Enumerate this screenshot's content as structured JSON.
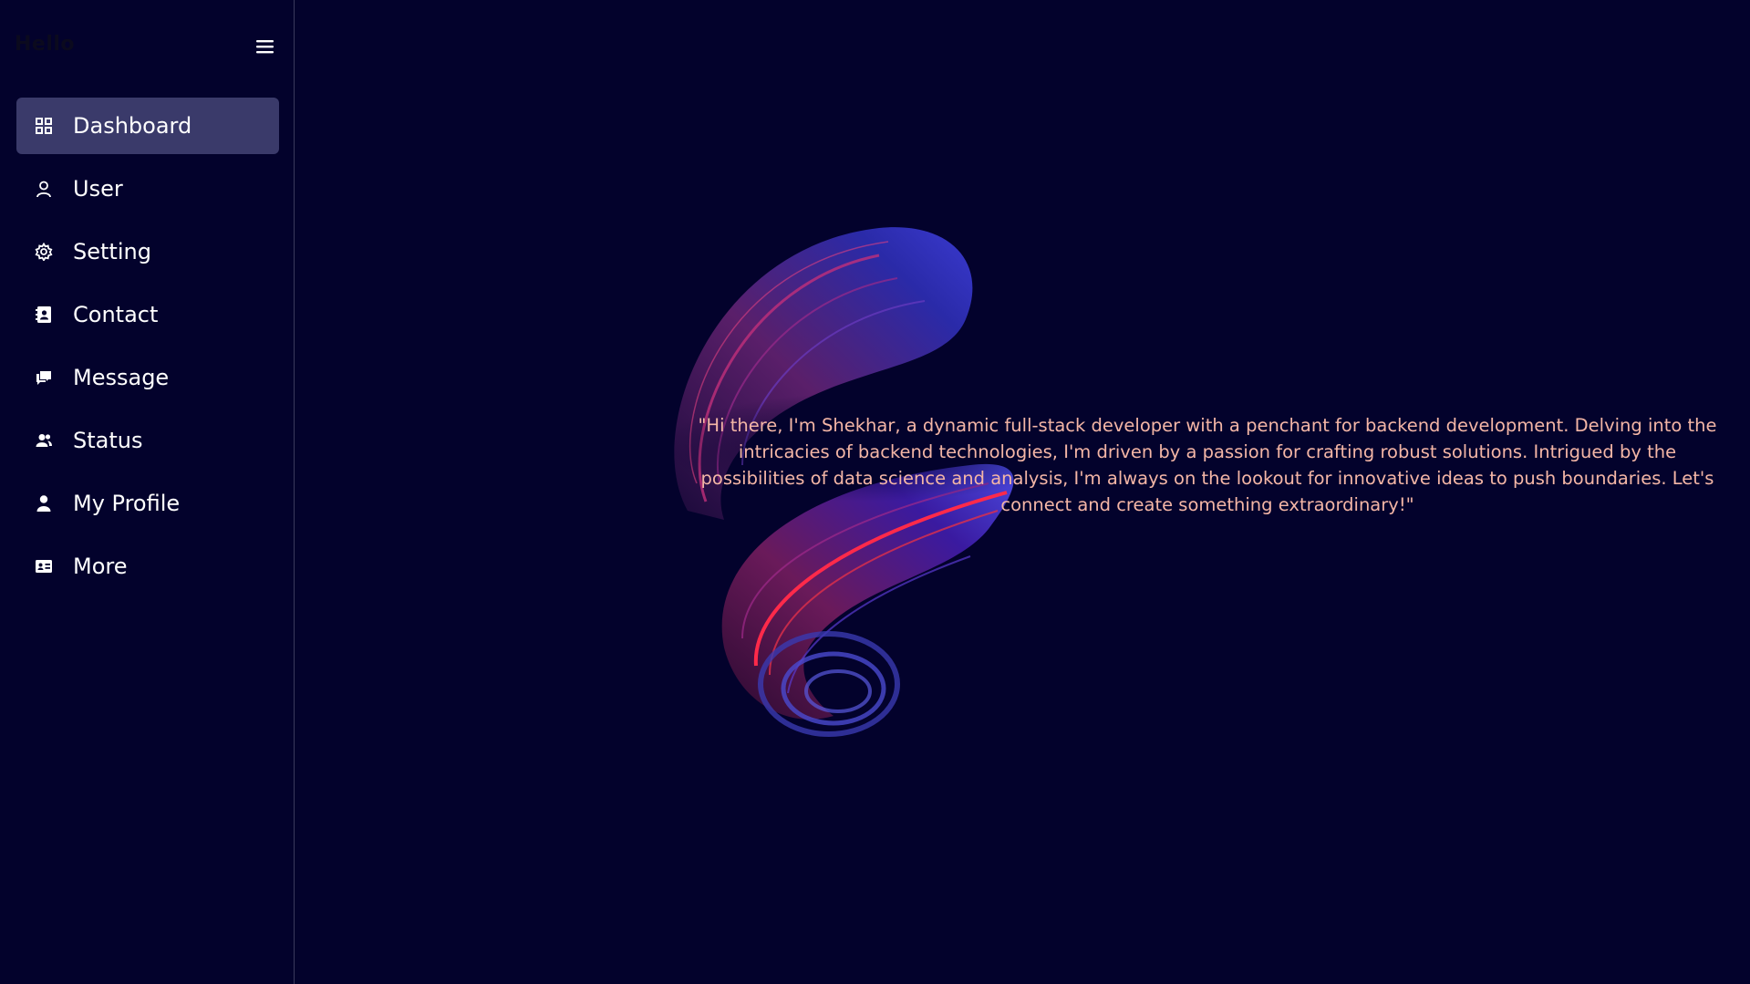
{
  "sidebar": {
    "brand": "Hello",
    "items": [
      {
        "label": "Dashboard",
        "icon": "grid-icon",
        "active": true
      },
      {
        "label": "User",
        "icon": "user-outline-icon",
        "active": false
      },
      {
        "label": "Setting",
        "icon": "gear-icon",
        "active": false
      },
      {
        "label": "Contact",
        "icon": "contact-book-icon",
        "active": false
      },
      {
        "label": "Message",
        "icon": "chat-icon",
        "active": false
      },
      {
        "label": "Status",
        "icon": "users-icon",
        "active": false
      },
      {
        "label": "My Profile",
        "icon": "person-icon",
        "active": false
      },
      {
        "label": "More",
        "icon": "id-card-icon",
        "active": false
      }
    ]
  },
  "main": {
    "bio": "\"Hi there, I'm Shekhar, a dynamic full-stack developer with a penchant for backend development. Delving into the intricacies of backend technologies, I'm driven by a passion for crafting robust solutions. Intrigued by the possibilities of data science and analysis, I'm always on the lookout for innovative ideas to push boundaries. Let's connect and create something extraordinary!\""
  },
  "colors": {
    "background": "#03022c",
    "active_item": "#3a3a6a",
    "bio_text": "#f4b6a6",
    "divider": "#3a3a5c"
  }
}
